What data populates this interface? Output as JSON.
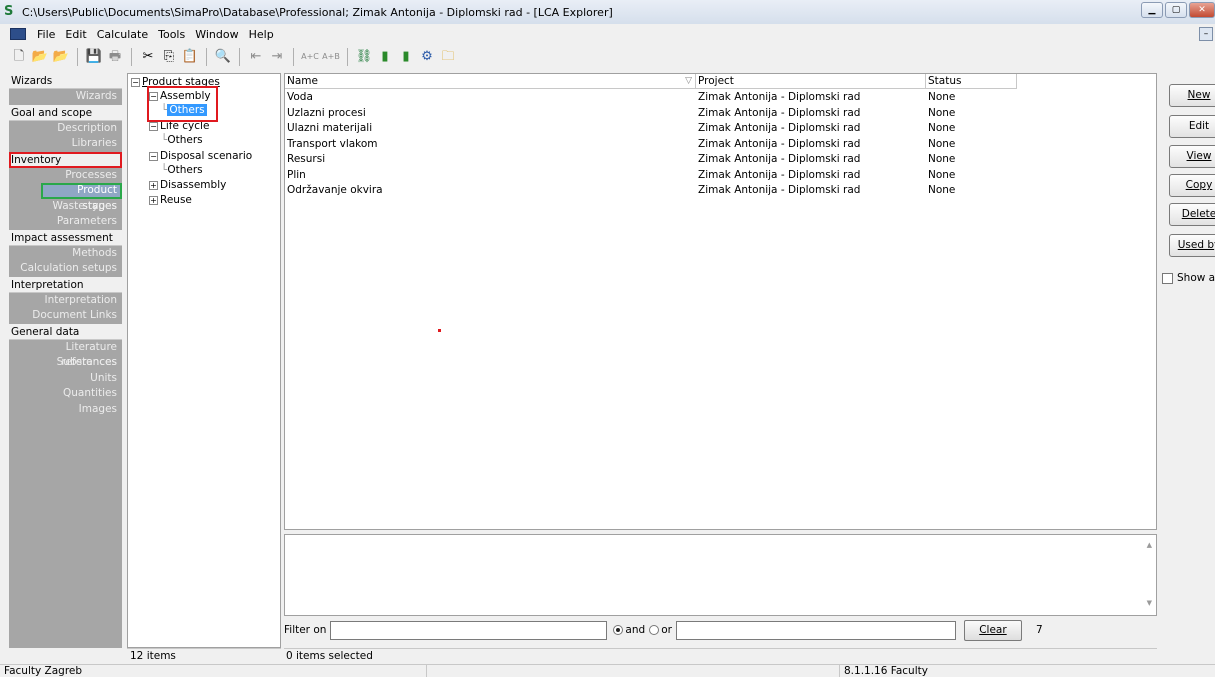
{
  "window": {
    "title": "C:\\Users\\Public\\Documents\\SimaPro\\Database\\Professional; Zimak Antonija - Diplomski rad - [LCA Explorer]",
    "app_icon": "S"
  },
  "menu": {
    "items": [
      "File",
      "Edit",
      "Calculate",
      "Tools",
      "Window",
      "Help"
    ]
  },
  "toolbar": {
    "icons": [
      "new-icon",
      "open-icon",
      "open-project-icon",
      "save-icon",
      "print-icon",
      "cut-icon",
      "copy-icon",
      "paste-icon",
      "search-icon",
      "import-icon",
      "export-icon",
      "calculate-icon",
      "compare-icon",
      "network-icon",
      "analyze-icon",
      "chart-icon",
      "process-icon",
      "folder-icon"
    ]
  },
  "wizard": {
    "sections": [
      {
        "header": "Wizards",
        "items": [
          "Wizards"
        ]
      },
      {
        "header": "Goal and scope",
        "items": [
          "Description",
          "Libraries"
        ]
      },
      {
        "header": "Inventory",
        "items": [
          "Processes",
          "Product stages",
          "Waste types",
          "Parameters"
        ]
      },
      {
        "header": "Impact assessment",
        "items": [
          "Methods",
          "Calculation setups"
        ]
      },
      {
        "header": "Interpretation",
        "items": [
          "Interpretation",
          "Document Links"
        ]
      },
      {
        "header": "General data",
        "items": [
          "Literature references",
          "Substances",
          "Units",
          "Quantities",
          "Images"
        ]
      }
    ],
    "selected": "Product stages"
  },
  "tree": {
    "root": "Product stages",
    "nodes": [
      {
        "label": "Assembly",
        "expanded": true,
        "children": [
          "Others"
        ]
      },
      {
        "label": "Life cycle",
        "expanded": true,
        "children": [
          "Others"
        ]
      },
      {
        "label": "Disposal scenario",
        "expanded": true,
        "children": [
          "Others"
        ]
      },
      {
        "label": "Disassembly",
        "expanded": false,
        "children": []
      },
      {
        "label": "Reuse",
        "expanded": false,
        "children": []
      }
    ],
    "selected": "Others",
    "item_count": "12 items"
  },
  "list": {
    "columns": [
      "Name",
      "Project",
      "Status"
    ],
    "rows": [
      {
        "name": "Voda",
        "project": "Zimak Antonija - Diplomski rad",
        "status": "None"
      },
      {
        "name": "Uzlazni procesi",
        "project": "Zimak Antonija - Diplomski rad",
        "status": "None"
      },
      {
        "name": "Ulazni materijali",
        "project": "Zimak Antonija - Diplomski rad",
        "status": "None"
      },
      {
        "name": "Transport vlakom",
        "project": "Zimak Antonija - Diplomski rad",
        "status": "None"
      },
      {
        "name": "Resursi",
        "project": "Zimak Antonija - Diplomski rad",
        "status": "None"
      },
      {
        "name": "Plin",
        "project": "Zimak Antonija - Diplomski rad",
        "status": "None"
      },
      {
        "name": "Održavanje okvira",
        "project": "Zimak Antonija - Diplomski rad",
        "status": "None"
      }
    ],
    "selection_status": "0 items selected"
  },
  "filter": {
    "label": "Filter on",
    "value1": "",
    "value2": "",
    "and_label": "and",
    "or_label": "or",
    "mode": "and",
    "clear_label": "Clear",
    "count": "7"
  },
  "actions": {
    "buttons": [
      "New",
      "Edit",
      "View",
      "Copy",
      "Delete",
      "Used by"
    ],
    "show_as_label": "Show as"
  },
  "statusbar": {
    "left": "Faculty Zagreb",
    "middle": "",
    "right": "8.1.1.16 Faculty"
  },
  "colors": {
    "wizard_bg": "#a6a6a6",
    "selection": "#3399ff",
    "highlight_red": "#e0191f",
    "highlight_green": "#2aa84a"
  }
}
